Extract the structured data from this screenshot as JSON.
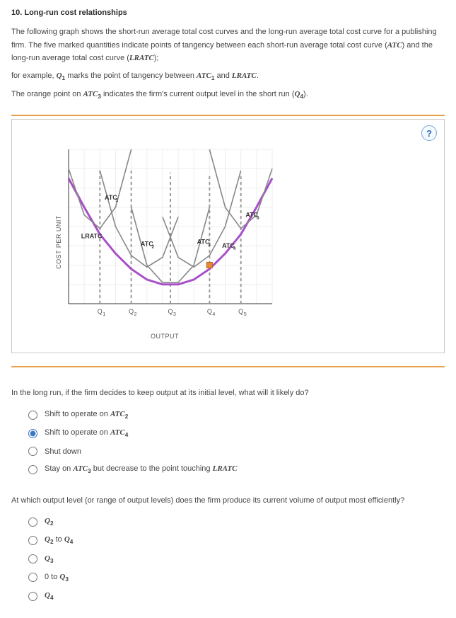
{
  "title": "10. Long-run cost relationships",
  "intro": {
    "p1a": "The following graph shows the short-run average total cost curves and the long-run average total cost curve for a publishing firm. The five marked quantities indicate points of tangency between each short-run average total cost curve (",
    "atc": "ATC",
    "p1b": ") and the long-run average total cost curve (",
    "lratc": "LRATC",
    "p1c": ");",
    "p2a": "for example, ",
    "q1": "Q",
    "q1sub": "1",
    "p2b": " marks the point of tangency between ",
    "atc1": "ATC",
    "atc1sub": "1",
    "p2c": " and ",
    "lratc2": "LRATC",
    "p2d": ".",
    "p3a": "The orange point on ",
    "atc3": "ATC",
    "atc3sub": "3",
    "p3b": " indicates the firm's current output level in the short run (",
    "q4": "Q",
    "q4sub": "4",
    "p3c": ")."
  },
  "chart_data": {
    "type": "line",
    "xlabel": "OUTPUT",
    "ylabel": "COST PER UNIT",
    "x": [
      1,
      2,
      3,
      4,
      5,
      6,
      7,
      8,
      9,
      10,
      11,
      12,
      13,
      14
    ],
    "series": [
      {
        "name": "LRATC",
        "color": "#a84fc9",
        "thick": true,
        "values": [
          190,
          160,
          132,
          112,
          96,
          85,
          80,
          80,
          85,
          96,
          112,
          132,
          160,
          190
        ]
      },
      {
        "name": "ATC1",
        "color": "#888",
        "values": [
          200,
          152,
          138,
          160,
          220,
          null,
          null,
          null,
          null,
          null,
          null,
          null,
          null,
          null
        ]
      },
      {
        "name": "ATC2",
        "color": "#888",
        "values": [
          null,
          null,
          198,
          140,
          110,
          98,
          108,
          150,
          null,
          null,
          null,
          null,
          null,
          null
        ]
      },
      {
        "name": "ATC3",
        "color": "#888",
        "values": [
          null,
          null,
          null,
          null,
          160,
          100,
          82,
          82,
          100,
          160,
          null,
          null,
          null,
          null
        ]
      },
      {
        "name": "ATC4",
        "color": "#888",
        "values": [
          null,
          null,
          null,
          null,
          null,
          null,
          150,
          108,
          98,
          110,
          140,
          198,
          null,
          null
        ]
      },
      {
        "name": "ATC5",
        "color": "#888",
        "values": [
          null,
          null,
          null,
          null,
          null,
          null,
          null,
          null,
          null,
          220,
          160,
          138,
          152,
          200
        ]
      }
    ],
    "tangency_x": [
      "Q1",
      "Q2",
      "Q3",
      "Q4",
      "Q5"
    ],
    "tangency_positions": [
      3,
      5,
      7.5,
      10,
      12
    ],
    "current_point": {
      "x": 10,
      "y": 100,
      "color": "#e88b2e"
    },
    "labels": [
      {
        "text": "ATC₁",
        "x": 4,
        "y": 45
      },
      {
        "text": "ATC₂",
        "x": 6,
        "y": 100
      },
      {
        "text": "ATC₃",
        "x": 9.4,
        "y": 96
      },
      {
        "text": "ATC₄",
        "x": 10.6,
        "y": 92
      },
      {
        "text": "ATC₅",
        "x": 12.2,
        "y": 60
      },
      {
        "text": "LRATC",
        "x": 1.6,
        "y": 100
      }
    ]
  },
  "help": "?",
  "question1": {
    "prompt": "In the long run, if the firm decides to keep output at its initial level, what will it likely do?",
    "options": [
      {
        "pre": "Shift to operate on ",
        "math": "ATC",
        "sub": "2",
        "post": ""
      },
      {
        "pre": "Shift to operate on ",
        "math": "ATC",
        "sub": "4",
        "post": ""
      },
      {
        "pre": "Shut down",
        "math": "",
        "sub": "",
        "post": ""
      },
      {
        "pre": "Stay on ",
        "math": "ATC",
        "sub": "3",
        "post": " but decrease to the point touching ",
        "math2": "LRATC"
      }
    ],
    "selected": 1
  },
  "question2": {
    "prompt": "At which output level (or range of output levels) does the firm produce its current volume of output most efficiently?",
    "options": [
      {
        "pre": "",
        "math": "Q",
        "sub": "2",
        "post": ""
      },
      {
        "pre": "",
        "math": "Q",
        "sub": "2",
        "post": " to ",
        "math2": "Q",
        "sub2": "4"
      },
      {
        "pre": "",
        "math": "Q",
        "sub": "3",
        "post": ""
      },
      {
        "pre": "0 to ",
        "math": "Q",
        "sub": "3",
        "post": ""
      },
      {
        "pre": "",
        "math": "Q",
        "sub": "4",
        "post": ""
      }
    ],
    "selected": -1
  }
}
